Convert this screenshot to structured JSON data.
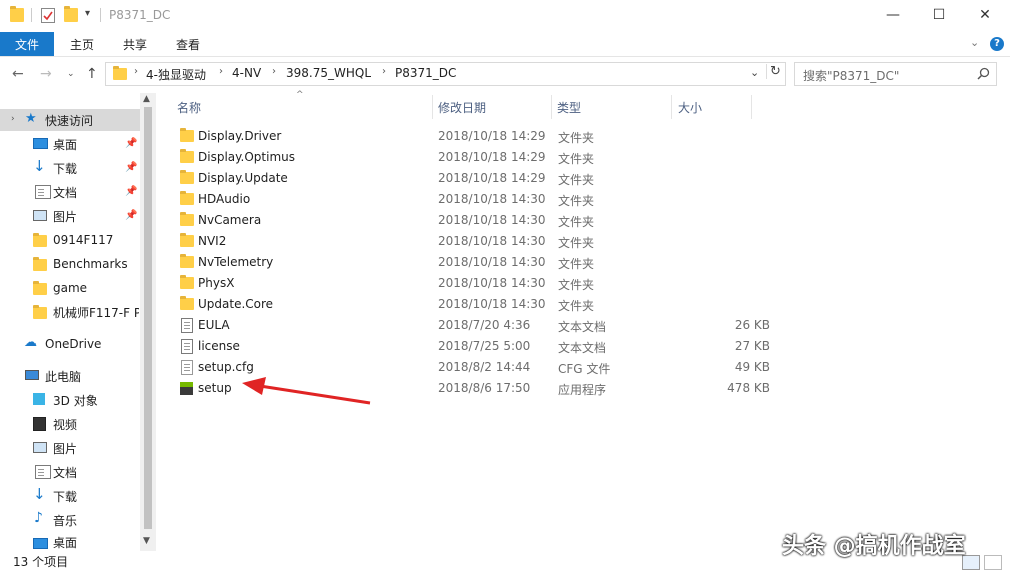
{
  "window": {
    "title": "P8371_DC",
    "minimize_glyph": "—",
    "maximize_glyph": "☐",
    "close_glyph": "✕"
  },
  "ribbon": {
    "tabs": [
      "文件",
      "主页",
      "共享",
      "查看"
    ]
  },
  "address": {
    "crumbs": [
      "4-独显驱动",
      "4-NV",
      "398.75_WHQL",
      "P8371_DC"
    ],
    "search_placeholder": "搜索\"P8371_DC\""
  },
  "sidebar": {
    "items": [
      {
        "label": "快速访问",
        "icon": "star-icon"
      },
      {
        "label": "桌面",
        "icon": "desktop-icon",
        "pinned": true
      },
      {
        "label": "下载",
        "icon": "download-icon",
        "pinned": true
      },
      {
        "label": "文档",
        "icon": "document-icon",
        "pinned": true
      },
      {
        "label": "图片",
        "icon": "pictures-icon",
        "pinned": true
      },
      {
        "label": "0914F117",
        "icon": "folder-icon"
      },
      {
        "label": "Benchmarks",
        "icon": "folder-icon"
      },
      {
        "label": "game",
        "icon": "folder-icon"
      },
      {
        "label": "机械师F117-F P",
        "icon": "folder-icon"
      },
      {
        "label": "OneDrive",
        "icon": "cloud-icon"
      },
      {
        "label": "此电脑",
        "icon": "computer-icon"
      },
      {
        "label": "3D 对象",
        "icon": "3d-objects-icon"
      },
      {
        "label": "视频",
        "icon": "video-icon"
      },
      {
        "label": "图片",
        "icon": "pictures-icon"
      },
      {
        "label": "文档",
        "icon": "document-icon"
      },
      {
        "label": "下载",
        "icon": "download-icon"
      },
      {
        "label": "音乐",
        "icon": "music-icon"
      },
      {
        "label": "桌面",
        "icon": "desktop-icon"
      }
    ]
  },
  "columns": {
    "name": "名称",
    "date": "修改日期",
    "type": "类型",
    "size": "大小"
  },
  "files": [
    {
      "name": "Display.Driver",
      "date": "2018/10/18 14:29",
      "type": "文件夹",
      "size": "",
      "icon": "folder-icon"
    },
    {
      "name": "Display.Optimus",
      "date": "2018/10/18 14:29",
      "type": "文件夹",
      "size": "",
      "icon": "folder-icon"
    },
    {
      "name": "Display.Update",
      "date": "2018/10/18 14:29",
      "type": "文件夹",
      "size": "",
      "icon": "folder-icon"
    },
    {
      "name": "HDAudio",
      "date": "2018/10/18 14:30",
      "type": "文件夹",
      "size": "",
      "icon": "folder-icon"
    },
    {
      "name": "NvCamera",
      "date": "2018/10/18 14:30",
      "type": "文件夹",
      "size": "",
      "icon": "folder-icon"
    },
    {
      "name": "NVI2",
      "date": "2018/10/18 14:30",
      "type": "文件夹",
      "size": "",
      "icon": "folder-icon"
    },
    {
      "name": "NvTelemetry",
      "date": "2018/10/18 14:30",
      "type": "文件夹",
      "size": "",
      "icon": "folder-icon"
    },
    {
      "name": "PhysX",
      "date": "2018/10/18 14:30",
      "type": "文件夹",
      "size": "",
      "icon": "folder-icon"
    },
    {
      "name": "Update.Core",
      "date": "2018/10/18 14:30",
      "type": "文件夹",
      "size": "",
      "icon": "folder-icon"
    },
    {
      "name": "EULA",
      "date": "2018/7/20 4:36",
      "type": "文本文档",
      "size": "26 KB",
      "icon": "text-file-icon"
    },
    {
      "name": "license",
      "date": "2018/7/25 5:00",
      "type": "文本文档",
      "size": "27 KB",
      "icon": "text-file-icon"
    },
    {
      "name": "setup.cfg",
      "date": "2018/8/2 14:44",
      "type": "CFG 文件",
      "size": "49 KB",
      "icon": "file-icon"
    },
    {
      "name": "setup",
      "date": "2018/8/6 17:50",
      "type": "应用程序",
      "size": "478 KB",
      "icon": "setup-app-icon"
    }
  ],
  "status": {
    "item_count": "13 个项目"
  },
  "watermark": "头条 @搞机作战室",
  "colors": {
    "accent": "#1979ca",
    "folder": "#ffcf48",
    "arrow": "#e02424"
  }
}
